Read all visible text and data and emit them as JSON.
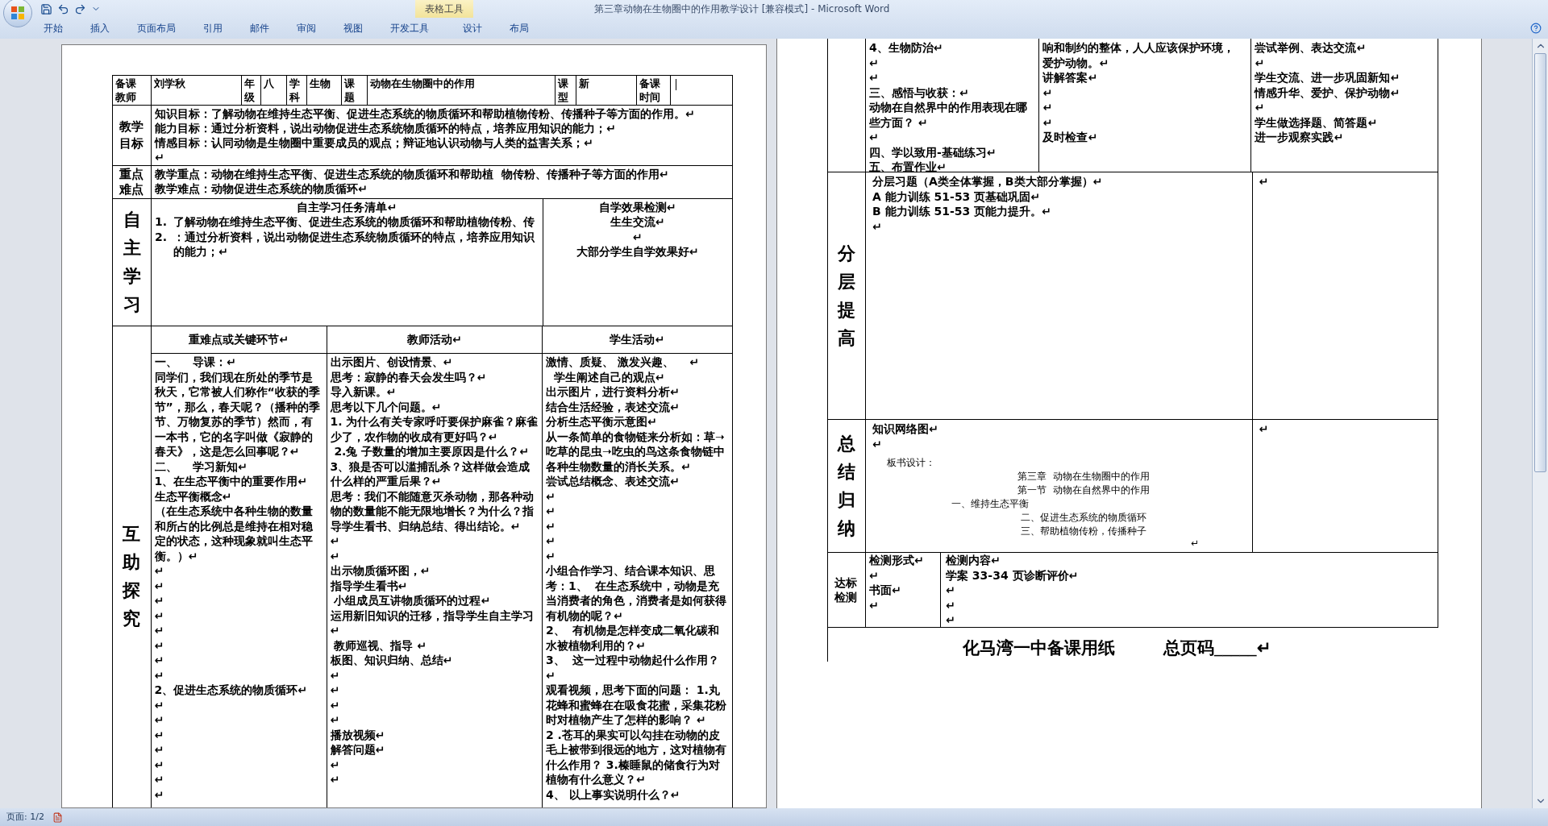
{
  "window": {
    "title": "第三章动物在生物圈中的作用教学设计 [兼容模式] - Microsoft Word",
    "contextual_tab": "表格工具"
  },
  "ribbon_tabs": [
    {
      "label": "开始",
      "selected": false
    },
    {
      "label": "插入",
      "selected": false
    },
    {
      "label": "页面布局",
      "selected": false
    },
    {
      "label": "引用",
      "selected": false
    },
    {
      "label": "邮件",
      "selected": false
    },
    {
      "label": "审阅",
      "selected": false
    },
    {
      "label": "视图",
      "selected": false
    },
    {
      "label": "开发工具",
      "selected": false
    },
    {
      "label": "设计",
      "selected": false
    },
    {
      "label": "布局",
      "selected": false
    }
  ],
  "left_page": {
    "header": [
      {
        "text": "备课教师",
        "kind": "label"
      },
      {
        "text": "刘学秋",
        "kind": "value"
      },
      {
        "text": "年级",
        "kind": "label"
      },
      {
        "text": "八",
        "kind": "value"
      },
      {
        "text": "学科",
        "kind": "label"
      },
      {
        "text": "生物",
        "kind": "value"
      },
      {
        "text": "课题",
        "kind": "label"
      },
      {
        "text": "动物在生物圈中的作用",
        "kind": "value"
      },
      {
        "text": "课型",
        "kind": "label"
      },
      {
        "text": "新",
        "kind": "value"
      },
      {
        "text": "备课时间",
        "kind": "label"
      }
    ],
    "objectives": {
      "label": "教学目标",
      "lines": [
        "知识目标：了解动物在维持生态平衡、促进生态系统的物质循环和帮助植物传粉、传播种子等方面的作用。↵",
        "能力目标：通过分析资料，说出动物促进生态系统物质循环的特点，培养应用知识的能力；↵",
        "情感目标：认同动物是生物圈中重要成员的观点；辩证地认识动物与人类的益害关系；↵",
        "↵"
      ]
    },
    "key_points": {
      "label": "重点难点",
      "lines": [
        "教学重点：动物在维持生态平衡、促进生态系统的物质循环和帮助植  物传粉、传播种子等方面的作用↵",
        "教学难点：动物促进生态系统的物质循环↵"
      ]
    },
    "self_study": {
      "label": "自主学习",
      "task_title": "自主学习任务清单↵",
      "tasks": [
        {
          "number": "1.",
          "text": "了解动物在维持生态平衡、促进生态系统的物质循环和帮助植物传粉、传"
        },
        {
          "number": "2.",
          "text": "：通过分析资料，说出动物促进生态系统物质循环的特点，培养应用知识的能力；↵"
        }
      ],
      "check_lines": [
        "自学效果检测↵",
        "生生交流↵",
        "↵",
        "大部分学生自学效果好↵"
      ]
    },
    "inquiry": {
      "label": "互助探究",
      "columns": [
        {
          "heading": "重难点或关键环节↵",
          "paragraphs": [
            "一、    导课：↵",
            "同学们，我们现在所处的季节是秋天，它常被人们称作“收获的季节”，那么，春天呢？（播种的季节、万物复苏的季节）然而，有一本书，它的名字叫做《寂静的春天》，这是怎么回事呢？↵",
            "二、    学习新知↵",
            "1、在生态平衡中的重要作用↵",
            "生态平衡概念↵",
            "（在生态系统中各种生物的数量和所占的比例总是维持在相对稳定的状态，这种现象就叫生态平衡。）↵",
            "↵",
            "↵",
            "↵",
            "↵",
            "↵",
            "↵",
            "↵",
            "↵",
            "2、促进生态系统的物质循环↵",
            "↵",
            "↵",
            "↵",
            "↵",
            "↵",
            "↵",
            "↵"
          ]
        },
        {
          "heading": "教师活动↵",
          "paragraphs": [
            "出示图片、创设情景、↵",
            "思考：寂静的春天会发生吗？↵",
            "导入新课。↵",
            "思考以下几个问题。↵",
            "1. 为什么有关专家呼吁要保护麻雀？麻雀少了，农作物的收成有更好吗？↵",
            " 2.兔 子数量的增加主要原因是什么？↵",
            "3、狼是否可以滥捕乱杀？这样做会造成什么样的严重后果？↵",
            "思考：我们不能随意灭杀动物，那各种动物的数量能不能无限地增长？为什么？指导学生看书、归纳总结、得出结论。↵",
            "↵",
            "↵",
            "出示物质循环图，↵",
            "指导学生看书↵",
            " 小组成员互讲物质循环的过程↵",
            "运用新旧知识的迁移，指导学生自主学习↵",
            " 教师巡视、指导 ↵",
            "板图、知识归纳、总结↵",
            "↵",
            "↵",
            "↵",
            "↵",
            "播放视频↵",
            "解答问题↵",
            "↵",
            "↵"
          ]
        },
        {
          "heading": "学生活动↵",
          "paragraphs": [
            "激情、质疑、 激发兴趣、    ↵",
            "  学生阐述自己的观点↵",
            "出示图片，进行资料分析↵",
            "结合生活经验，表述交流↵",
            "分析生态平衡示意图↵",
            "从一条简单的食物链来分析如：草➝吃草的昆虫➝吃虫的鸟这条食物链中各种生物数量的消长关系。↵",
            "尝试总结概念、表述交流↵",
            "↵",
            "↵",
            "↵",
            "↵",
            "↵",
            "小组合作学习、结合课本知识、思考：1、  在生态系统中，动物是充当消费者的角色，消费者是如何获得有机物的呢？↵",
            "2、  有机物是怎样变成二氧化碳和水被植物利用的？↵",
            "3、  这一过程中动物起什么作用？ ↵",
            "观看视频，思考下面的问题： 1.丸花蜂和蜜蜂在在吸食花蜜，采集花粉时对植物产生了怎样的影响？ ↵",
            "2 .苍耳的果实可以勾挂在动物的皮毛上被带到很远的地方，这对植物有什么作用？ 3.榛睡鼠的储食行为对植物有什么意义？↵",
            "4、 以上事实说明什么？↵"
          ]
        }
      ]
    }
  },
  "right_page": {
    "continued_columns": [
      [
        "4、生物防治↵",
        "↵",
        "↵",
        "三、感悟与收获：↵",
        "动物在自然界中的作用表现在哪些方面？ ↵",
        "↵",
        "四、学以致用-基础练习↵",
        "五、布置作业↵"
      ],
      [
        "响和制约的整体，人人应该保护环境，",
        "爱护动物。↵",
        "讲解答案↵",
        "↵",
        "↵",
        "↵",
        "及时检查↵"
      ],
      [
        "尝试举例、表达交流↵",
        "↵",
        "学生交流、进一步巩固新知↵",
        "情感升华、爱护、保护动物↵",
        "↵",
        "学生做选择题、简答题↵",
        "进一步观察实践↵"
      ]
    ],
    "tiered": {
      "label": "分层提高",
      "lines": [
        "分层习题（A类全体掌握，B类大部分掌握）↵",
        "A 能力训练 51-53 页基础巩固↵",
        "B 能力训练 51-53 页能力提升。↵",
        "↵"
      ],
      "side": "↵"
    },
    "summary": {
      "label": "总结归纳",
      "title": "知识网络图↵",
      "lines": [
        {
          "text": "↵",
          "kind": "blank"
        },
        {
          "text": "板书设计：",
          "kind": "board_title"
        },
        {
          "text": "第三章  动物在生物圈中的作用",
          "kind": "heading"
        },
        {
          "text": "第一节  动物在自然界中的作用",
          "kind": "heading"
        },
        {
          "text": "一、维持生态平衡",
          "kind": "item_main"
        },
        {
          "text": "二、促进生态系统的物质循环",
          "kind": "item_sub"
        },
        {
          "text": "三、帮助植物传粉，传播种子",
          "kind": "item_sub"
        },
        {
          "text": "↵",
          "kind": "end_mark"
        }
      ],
      "side": "↵"
    },
    "assessment": {
      "label": "达标检测",
      "form_lines": [
        "检测形式↵",
        "↵",
        "书面↵",
        "↵"
      ],
      "content_lines": [
        "检测内容↵",
        "学案 33-34 页诊断评价↵",
        "↵",
        "↵",
        "↵"
      ]
    },
    "footer": {
      "school_paper": "化马湾一中备课用纸",
      "page_total": "总页码_____↵"
    }
  },
  "status_bar": {
    "page": "页面: 1/2"
  }
}
